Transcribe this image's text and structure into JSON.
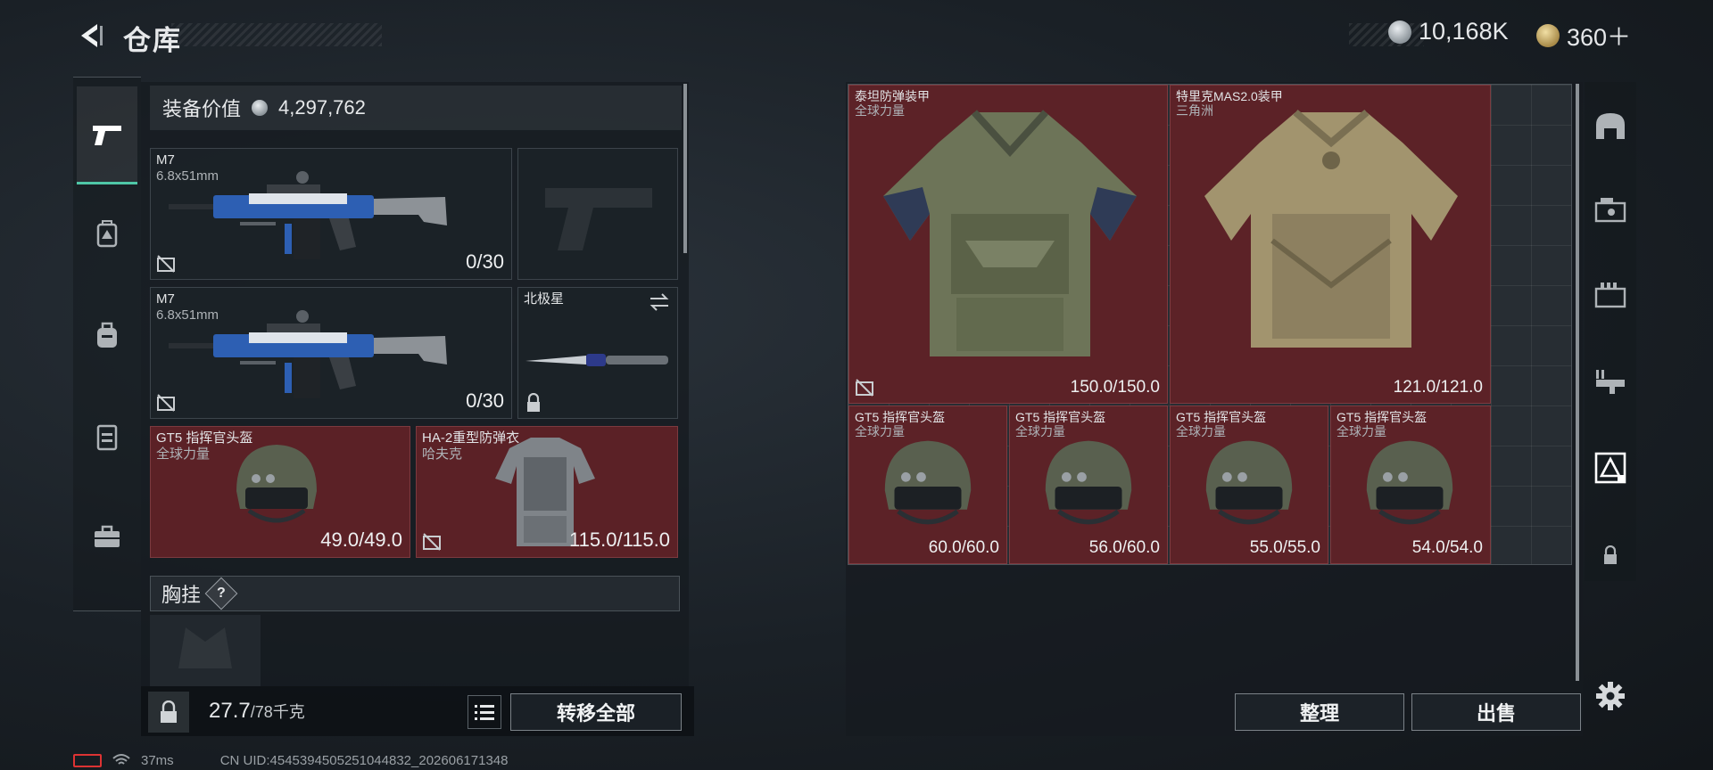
{
  "header": {
    "title": "仓库",
    "currency_silver": "10,168K",
    "currency_gold": "360＋"
  },
  "colors": {
    "accent": "#4fc7a7",
    "slot_red": "#5b2126",
    "panel": "#1a2026"
  },
  "left_sidebar": {
    "items": [
      {
        "icon": "pistol-icon",
        "active": true
      },
      {
        "icon": "backpack-armor-icon",
        "active": false
      },
      {
        "icon": "backpack-icon",
        "active": false
      },
      {
        "icon": "vest-icon",
        "active": false
      },
      {
        "icon": "briefcase-icon",
        "active": false
      }
    ]
  },
  "loadout": {
    "equip_value_label": "装备价值",
    "equip_value": "4,297,762",
    "slots": [
      {
        "name": "M7",
        "sub": "6.8x51mm",
        "value": "0/30",
        "type": "rifle"
      },
      {
        "name": "",
        "sub": "",
        "value": "",
        "type": "pistol-empty"
      },
      {
        "name": "M7",
        "sub": "6.8x51mm",
        "value": "0/30",
        "type": "rifle"
      },
      {
        "name": "北极星",
        "sub": "",
        "value": "",
        "type": "knife"
      },
      {
        "name": "GT5 指挥官头盔",
        "sub": "全球力量",
        "value": "49.0/49.0",
        "type": "helmet"
      },
      {
        "name": "HA-2重型防弹衣",
        "sub": "哈夫克",
        "value": "115.0/115.0",
        "type": "armor"
      }
    ],
    "chest_label": "胸挂",
    "chest_help": "?"
  },
  "bottom": {
    "weight": "27.7",
    "weight_max": "/78千克",
    "transfer_all": "转移全部",
    "sort": "整理",
    "sell": "出售"
  },
  "storage": {
    "items": [
      {
        "name": "泰坦防弹装甲",
        "sub": "全球力量",
        "value": "150.0/150.0",
        "type": "armor-big"
      },
      {
        "name": "特里克MAS2.0装甲",
        "sub": "三角洲",
        "value": "121.0/121.0",
        "type": "armor-camo"
      },
      {
        "name": "GT5 指挥官头盔",
        "sub": "全球力量",
        "value": "60.0/60.0",
        "type": "helmet"
      },
      {
        "name": "GT5 指挥官头盔",
        "sub": "全球力量",
        "value": "56.0/60.0",
        "type": "helmet"
      },
      {
        "name": "GT5 指挥官头盔",
        "sub": "全球力量",
        "value": "55.0/55.0",
        "type": "helmet"
      },
      {
        "name": "GT5 指挥官头盔",
        "sub": "全球力量",
        "value": "54.0/54.0",
        "type": "helmet"
      }
    ]
  },
  "right_sidebar": {
    "items": [
      "bunker-icon",
      "weapon-crate-icon",
      "ammo-box-icon",
      "gun-rack-icon",
      "armor-crate-icon",
      "lock-icon"
    ]
  },
  "footer": {
    "ping": "37ms",
    "uid": "CN UID:4545394505251044832_202606171348"
  }
}
